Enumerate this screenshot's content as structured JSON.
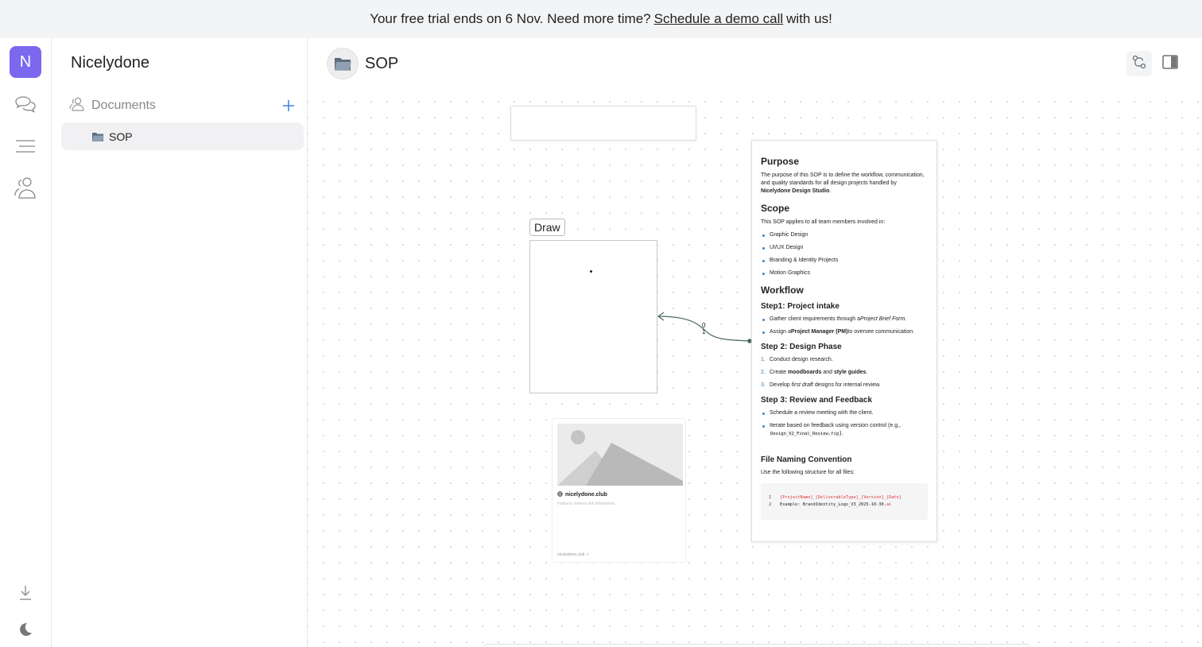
{
  "banner": {
    "prefix": "Your free trial ends on 6 Nov. Need more time?",
    "link": "Schedule a demo call",
    "suffix": "with us!"
  },
  "rail": {
    "avatar_letter": "N",
    "accent": "#7b68ee"
  },
  "sidebar": {
    "workspace_name": "Nicelydone",
    "section_label": "Documents",
    "items": [
      {
        "label": "SOP"
      }
    ]
  },
  "header": {
    "title": "SOP"
  },
  "canvas": {
    "draw_label": "Draw",
    "edge_labels": [
      "0",
      "1"
    ],
    "link_card": {
      "domain": "nicelydone.club",
      "error": "Failed to retrieve link information.",
      "footer": "nicelydone.club"
    },
    "doc": {
      "purpose_heading": "Purpose",
      "purpose_text": "The purpose of this SOP is to define the workflow, communication, and quality standards for all design projects handled by",
      "purpose_bold": "Nicelydone Design Studio",
      "purpose_end": ".",
      "scope_heading": "Scope",
      "scope_text": "This SOP applies to all team members involved in:",
      "scope_items": [
        "Graphic Design",
        "UI/UX Design",
        "Branding & Identity Projects",
        "Motion Graphics"
      ],
      "workflow_heading": "Workflow",
      "step1_heading": "Step1: Project intake",
      "step1_a_pre": "Gather client requirements through a",
      "step1_a_em": "Project Brief Form",
      "step1_a_post": ".",
      "step1_b_pre": "Assign a",
      "step1_b_bold": "Project Manager (PM)",
      "step1_b_post": "to oversee communication.",
      "step2_heading": "Step 2: Design Phase",
      "step2_1": "Conduct design research.",
      "step2_2_pre": "Create",
      "step2_2_b1": "moodboards",
      "step2_2_mid": "and",
      "step2_2_b2": "style guides",
      "step2_2_post": ".",
      "step2_3_pre": "Develop",
      "step2_3_em": "first draft",
      "step2_3_post": "designs for internal review.",
      "step3_heading": "Step 3: Review and Feedback",
      "step3_a": "Schedule a review meeting with the client.",
      "step3_b_pre": "Iterate based on feedback using version control (e.g.,",
      "step3_b_code": "Design_V2_Final_Review.fig",
      "step3_b_post": ").",
      "naming_heading": "File Naming Convention",
      "naming_text": "Use the following structure for all files:",
      "code_line1": "[ProjectName]_[DeliverableType]_[Version]_[Date]",
      "code_line2_pre": "Example: BrandIdentity_Logo_V3_2025-10-30.",
      "code_line2_ext": "ai",
      "code_ln1": "1",
      "code_ln2": "2"
    }
  }
}
